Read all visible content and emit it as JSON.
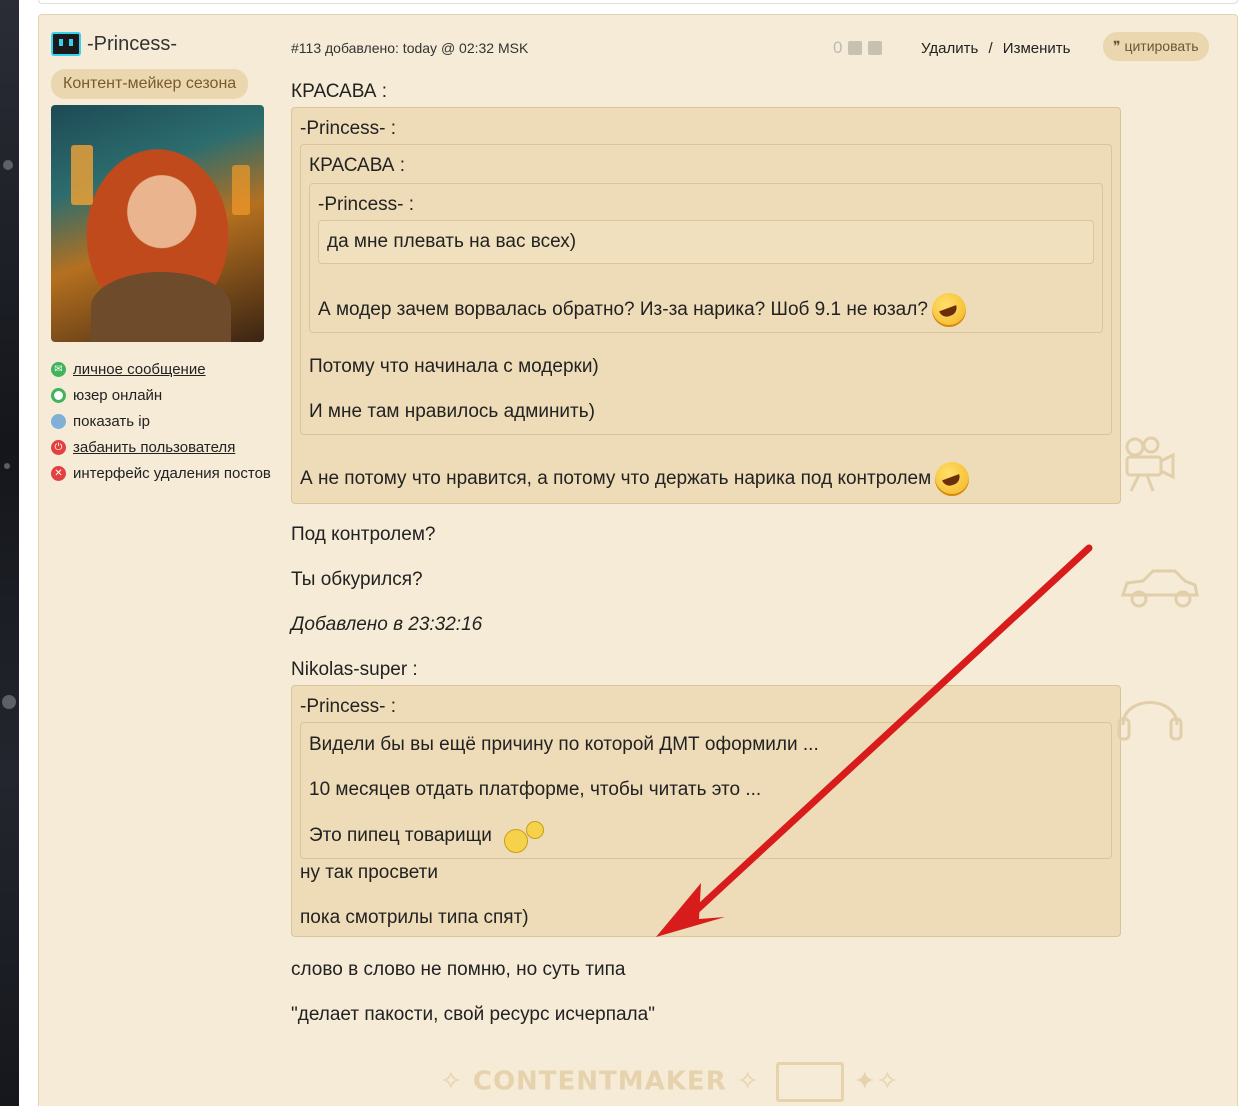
{
  "author": {
    "name": "-Princess-",
    "badge": "Контент-мейкер сезона",
    "links": [
      {
        "label": "личное сообщение"
      },
      {
        "label": "юзер онлайн"
      },
      {
        "label": "показать ip"
      },
      {
        "label": "забанить пользователя"
      },
      {
        "label": "интерфейс удаления постов"
      }
    ]
  },
  "post": {
    "meta": "#113 добавлено: today @ 02:32 MSK",
    "rating": "0",
    "delete_label": "Удалить",
    "separator": "/",
    "edit_label": "Изменить",
    "quote_label": "цитировать",
    "quote_icon": "❞"
  },
  "content": {
    "q1_author": "КРАСАВА :",
    "q1_inner_author": "-Princess- :",
    "q2_author": "КРАСАВА :",
    "q3_author": "-Princess- :",
    "q3_text": "да мне плевать на вас всех)",
    "q2_text": "А модер зачем ворвалась обратно? Из-за нарика? Шоб 9.1 не юзал?",
    "q1b_line1": "Потому что начинала с модерки)",
    "q1b_line2": "И мне там нравилось админить)",
    "q1_text": "А не потому что нравится, а потому что держать нарика под контролем",
    "reply1": "Под контролем?",
    "reply2": "Ты обкурился?",
    "added": "Добавлено в 23:32:16",
    "q4_author": "Nikolas-super :",
    "q5_author": "-Princess- :",
    "q5_line1": "Видели бы вы ещё причину по которой ДМТ оформили ...",
    "q5_line2": "10 месяцев отдать платформе, чтобы читать это ...",
    "q5_line3": "Это пипец товарищи",
    "q4_line1": "ну так просвети",
    "q4_line2": "пока смотрилы типа спят)",
    "reply3": "слово в слово не помню, но суть типа",
    "reply4": "\"делает пакости, свой ресурс исчерпала\""
  },
  "footer": {
    "watermark": "CONTENTMAKER"
  },
  "colors": {
    "post_bg": "#f6ebd6",
    "quote_bg": "#eedcb8",
    "arrow": "#d81c1c",
    "badge_bg": "#ead7b0"
  }
}
